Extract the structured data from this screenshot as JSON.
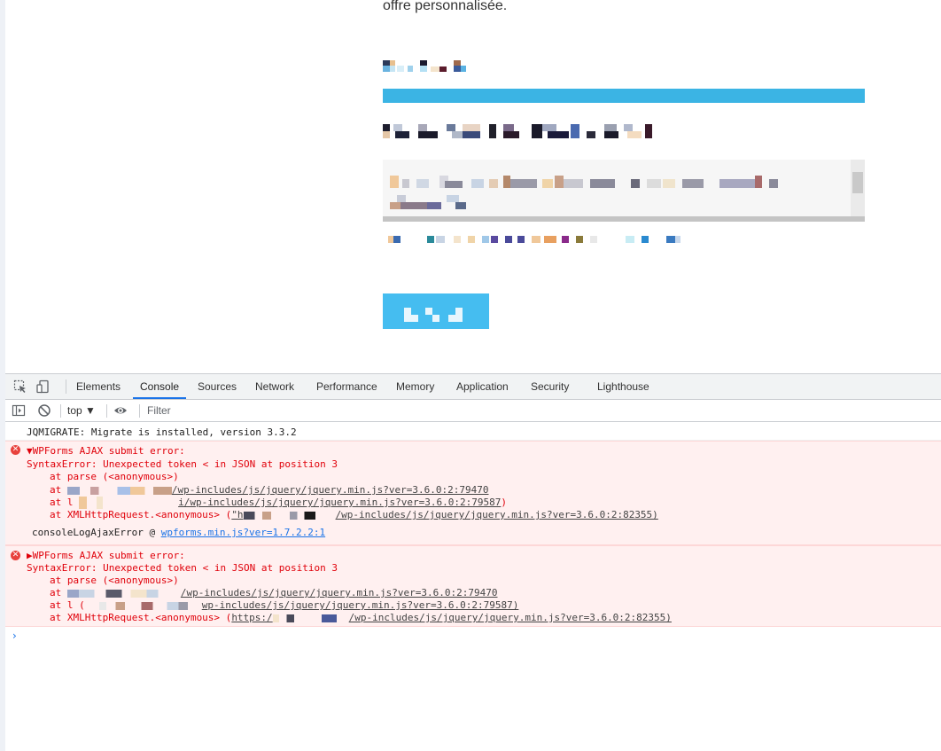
{
  "webpage": {
    "intro_text": "offre personnalisée.",
    "submit_label": ""
  },
  "devtools": {
    "tabs": [
      "Elements",
      "Console",
      "Sources",
      "Network",
      "Performance",
      "Memory",
      "Application",
      "Security",
      "Lighthouse"
    ],
    "active_tab": "Console",
    "context": "top ▼",
    "filter_placeholder": "Filter",
    "console": {
      "info": "JQMIGRATE: Migrate is installed, version 3.3.2",
      "error1": {
        "title": "▼WPForms AJAX submit error:",
        "message": "SyntaxError: Unexpected token < in JSON at position 3",
        "parse": "at parse (<anonymous>)",
        "at": "at",
        "url1": "/wp-includes/js/jquery/jquery.min.js?ver=3.6.0:2:79470",
        "at_l": "at l",
        "url2": "i/wp-includes/js/jquery/jquery.min.js?ver=3.6.0:2:79587",
        "close_paren": ")",
        "xhr_prefix": "at XMLHttpRequest.<anonymous> (",
        "xhr_host": "\"h",
        "url3": "/wp-includes/js/jquery/jquery.min.js?ver=3.6.0:2:82355)",
        "source_fn": "consoleLogAjaxError @",
        "source_link": "wpforms.min.js?ver=1.7.2.2:1"
      },
      "error2": {
        "title": "▶WPForms AJAX submit error:",
        "message": "SyntaxError: Unexpected token < in JSON at position 3",
        "parse": "at parse (<anonymous>)",
        "at": "at",
        "url1": "/wp-includes/js/jquery/jquery.min.js?ver=3.6.0:2:79470",
        "at_l": "at l (",
        "url2": "wp-includes/js/jquery/jquery.min.js?ver=3.6.0:2:79587)",
        "xhr_prefix": "at XMLHttpRequest.<anonymous> (",
        "xhr_host": "https:/",
        "url3": "/wp-includes/js/jquery/jquery.min.js?ver=3.6.0:2:82355)"
      },
      "prompt": "›"
    }
  },
  "colors": {
    "accent_blue": "#3bb4e4",
    "button_blue": "#45bdf0",
    "error_red": "#e0000a",
    "error_bg": "#fff0f0",
    "tab_active": "#1a73e8"
  },
  "icons": [
    "inspect-element-icon",
    "device-toolbar-icon",
    "sidebar-toggle-icon",
    "clear-console-icon",
    "eye-icon",
    "error-icon"
  ]
}
